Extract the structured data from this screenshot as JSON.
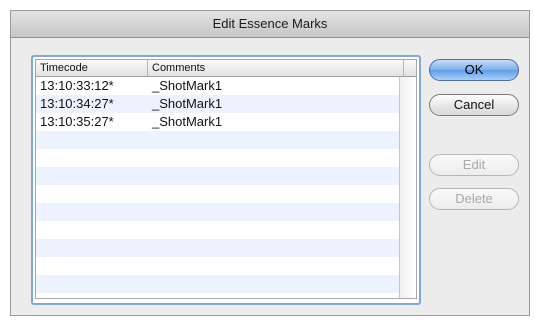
{
  "window": {
    "title": "Edit Essence Marks"
  },
  "table": {
    "columns": [
      "Timecode",
      "Comments"
    ],
    "rows": [
      {
        "timecode": "13:10:33:12*",
        "comment": "_ShotMark1"
      },
      {
        "timecode": "13:10:34:27*",
        "comment": "_ShotMark1"
      },
      {
        "timecode": "13:10:35:27*",
        "comment": "_ShotMark1"
      }
    ]
  },
  "buttons": {
    "ok": "OK",
    "cancel": "Cancel",
    "edit": "Edit",
    "delete": "Delete"
  },
  "colors": {
    "default_button": "#7ab0ea",
    "alt_row": "#edf3fe",
    "focus_ring": "#7fa7d8"
  }
}
